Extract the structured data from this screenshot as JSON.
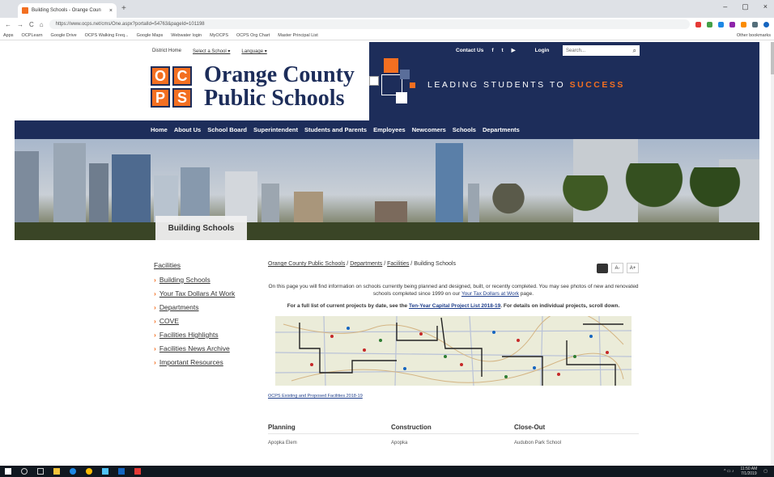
{
  "browser": {
    "tab_title": "Building Schools - Orange Coun",
    "tab_close": "×",
    "new_tab": "+",
    "url": "https://www.ocps.net/cms/One.aspx?portalId=54763&pageId=101198",
    "window_controls": [
      "–",
      "▢",
      "×"
    ],
    "nav_icons": [
      "←",
      "→",
      "C",
      "⌂"
    ],
    "bookmarks": [
      "Apps",
      "OCPLearn",
      "Google Drive",
      "OCPS Walking Freq...",
      "Google Maps",
      "Webwater login",
      "MyOCPS",
      "OCPS Org Chart",
      "Master Principal List"
    ],
    "other_bookmarks": "Other bookmarks"
  },
  "site": {
    "util_left": [
      "District Home",
      "Select a School ▾",
      "Language ▾"
    ],
    "util_right": {
      "contact": "Contact Us",
      "social": [
        "f",
        "t",
        "▶"
      ],
      "login": "Login"
    },
    "search_placeholder": "Search...",
    "logo_letters": [
      "O",
      "C",
      "P",
      "S"
    ],
    "logo_line1": "Orange County",
    "logo_line2": "Public Schools",
    "tagline_prefix": "LEADING STUDENTS TO ",
    "tagline_accent": "SUCCESS",
    "nav": [
      "Home",
      "About Us",
      "School Board",
      "Superintendent",
      "Students and Parents",
      "Employees",
      "Newcomers",
      "Schools",
      "Departments"
    ],
    "hero_label": "Building Schools"
  },
  "sidebar": {
    "heading": "Facilities",
    "items": [
      "Building Schools",
      "Your Tax Dollars At Work",
      "Departments",
      "COVE",
      "Facilities Highlights",
      "Facilities News Archive",
      "Important Resources"
    ]
  },
  "main": {
    "breadcrumb": [
      "Orange County Public Schools",
      "Departments",
      "Facilities",
      "Building Schools"
    ],
    "font_buttons": [
      "A-",
      "A+"
    ],
    "intro_text": "On this page you will find information on schools currently being planned and designed, built, or recently completed. You may see photos of new and renovated schools completed since 1999 on our ",
    "intro_link": "Your Tax Dollars at Work",
    "intro_end": " page.",
    "bold_text": "For a full list of current projects by date, see the ",
    "bold_link": "Ten-Year Capital Project List 2018-19",
    "bold_end": ". For details on individual projects, scroll down.",
    "map_link": "OCPS Existing and Proposed Facilities 2018-19",
    "columns": [
      "Planning",
      "Construction",
      "Close-Out"
    ],
    "row1": [
      "Apopka Elem",
      "Apopka",
      "Audubon Park School"
    ]
  },
  "taskbar": {
    "time": "11:50 AM",
    "date": "7/1/2019"
  },
  "colors": {
    "navy": "#1d2d5a",
    "orange": "#f36f21",
    "link": "#1d3d8a"
  }
}
